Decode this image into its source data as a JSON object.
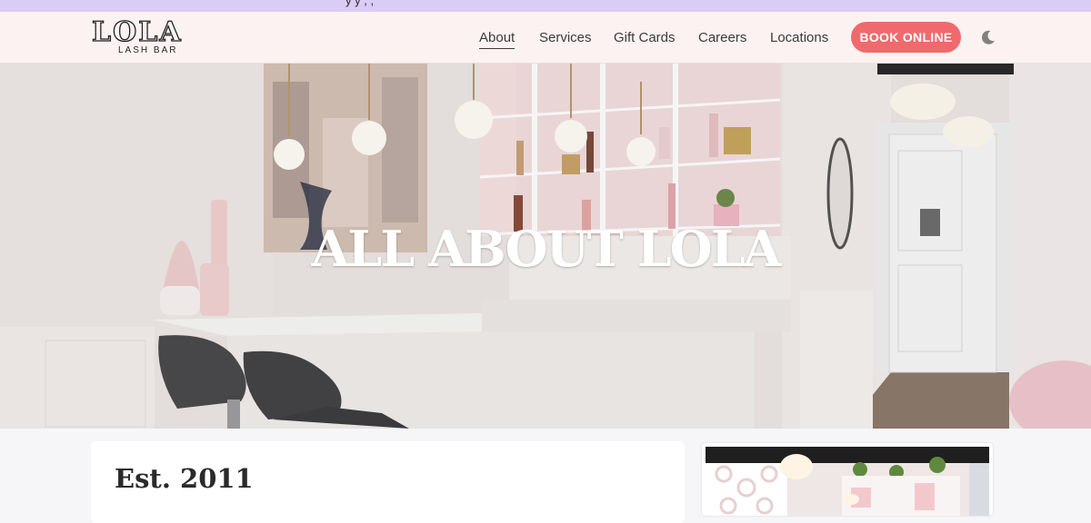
{
  "announcement": {
    "text": "y                    y ,  ,",
    "link_text": "                                        "
  },
  "brand": {
    "name": "LOLA",
    "tagline": "LASH BAR"
  },
  "nav": {
    "items": [
      {
        "label": "About"
      },
      {
        "label": "Services"
      },
      {
        "label": "Gift Cards"
      },
      {
        "label": "Careers"
      },
      {
        "label": "Locations"
      }
    ],
    "cta_label": "BOOK ONLINE",
    "theme_icon": "moon-icon"
  },
  "hero": {
    "title": "ALL ABOUT LOLA"
  },
  "intro": {
    "heading": "Est. 2011"
  },
  "colors": {
    "accent": "#f06a6d",
    "header_bg": "#fdf2f2",
    "announcement_bg": "#d9ccf6",
    "page_bg": "#f6f6f8"
  }
}
